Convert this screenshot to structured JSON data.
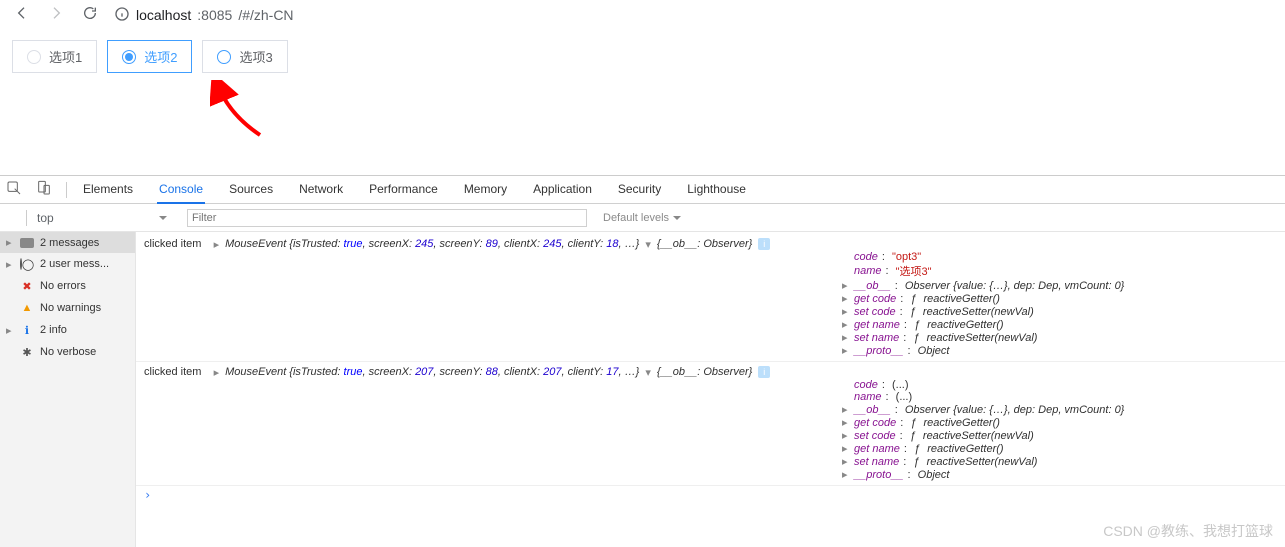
{
  "browser": {
    "url_host": "localhost",
    "url_port": ":8085",
    "url_path": "/#/zh-CN"
  },
  "page": {
    "options": [
      {
        "label": "选项1",
        "selected": false,
        "hover": false
      },
      {
        "label": "选项2",
        "selected": true,
        "hover": false
      },
      {
        "label": "选项3",
        "selected": false,
        "hover": true
      }
    ]
  },
  "devtools": {
    "tabs": [
      "Elements",
      "Console",
      "Sources",
      "Network",
      "Performance",
      "Memory",
      "Application",
      "Security",
      "Lighthouse"
    ],
    "active_tab": "Console",
    "context": "top",
    "filter_placeholder": "Filter",
    "levels_label": "Default levels",
    "sidebar": [
      {
        "icon": "msg",
        "text": "2 messages",
        "exp": true,
        "active": true
      },
      {
        "icon": "user",
        "text": "2 user mess...",
        "exp": true,
        "active": false
      },
      {
        "icon": "err",
        "text": "No errors",
        "exp": false,
        "active": false
      },
      {
        "icon": "warn",
        "text": "No warnings",
        "exp": false,
        "active": false
      },
      {
        "icon": "info",
        "text": "2 info",
        "exp": true,
        "active": false
      },
      {
        "icon": "gear",
        "text": "No verbose",
        "exp": false,
        "active": false
      }
    ],
    "logs": [
      {
        "prefix": "clicked item",
        "event_summary": "MouseEvent {isTrusted: true, screenX: 245, screenY: 89, clientX: 245, clientY: 18, …}",
        "header_tail": "{__ob__: Observer}",
        "props": [
          {
            "k": "code",
            "v": "\"opt3\"",
            "type": "str"
          },
          {
            "k": "name",
            "v": "\"选项3\"",
            "type": "str"
          },
          {
            "k": "__ob__",
            "v": "Observer {value: {…}, dep: Dep, vmCount: 0}",
            "type": "obj",
            "exp": true
          },
          {
            "k": "get code",
            "v": "ƒ reactiveGetter()",
            "type": "fn",
            "exp": true
          },
          {
            "k": "set code",
            "v": "ƒ reactiveSetter(newVal)",
            "type": "fn",
            "exp": true
          },
          {
            "k": "get name",
            "v": "ƒ reactiveGetter()",
            "type": "fn",
            "exp": true
          },
          {
            "k": "set name",
            "v": "ƒ reactiveSetter(newVal)",
            "type": "fn",
            "exp": true
          },
          {
            "k": "__proto__",
            "v": "Object",
            "type": "obj",
            "exp": true
          }
        ]
      },
      {
        "prefix": "clicked item",
        "event_summary": "MouseEvent {isTrusted: true, screenX: 207, screenY: 88, clientX: 207, clientY: 17, …}",
        "header_tail": "{__ob__: Observer}",
        "props": [
          {
            "k": "code",
            "v": "(...)",
            "type": "plain"
          },
          {
            "k": "name",
            "v": "(...)",
            "type": "plain"
          },
          {
            "k": "__ob__",
            "v": "Observer {value: {…}, dep: Dep, vmCount: 0}",
            "type": "obj",
            "exp": true
          },
          {
            "k": "get code",
            "v": "ƒ reactiveGetter()",
            "type": "fn",
            "exp": true
          },
          {
            "k": "set code",
            "v": "ƒ reactiveSetter(newVal)",
            "type": "fn",
            "exp": true
          },
          {
            "k": "get name",
            "v": "ƒ reactiveGetter()",
            "type": "fn",
            "exp": true
          },
          {
            "k": "set name",
            "v": "ƒ reactiveSetter(newVal)",
            "type": "fn",
            "exp": true
          },
          {
            "k": "__proto__",
            "v": "Object",
            "type": "obj",
            "exp": true
          }
        ]
      }
    ]
  },
  "watermark": "CSDN @教练、我想打篮球"
}
